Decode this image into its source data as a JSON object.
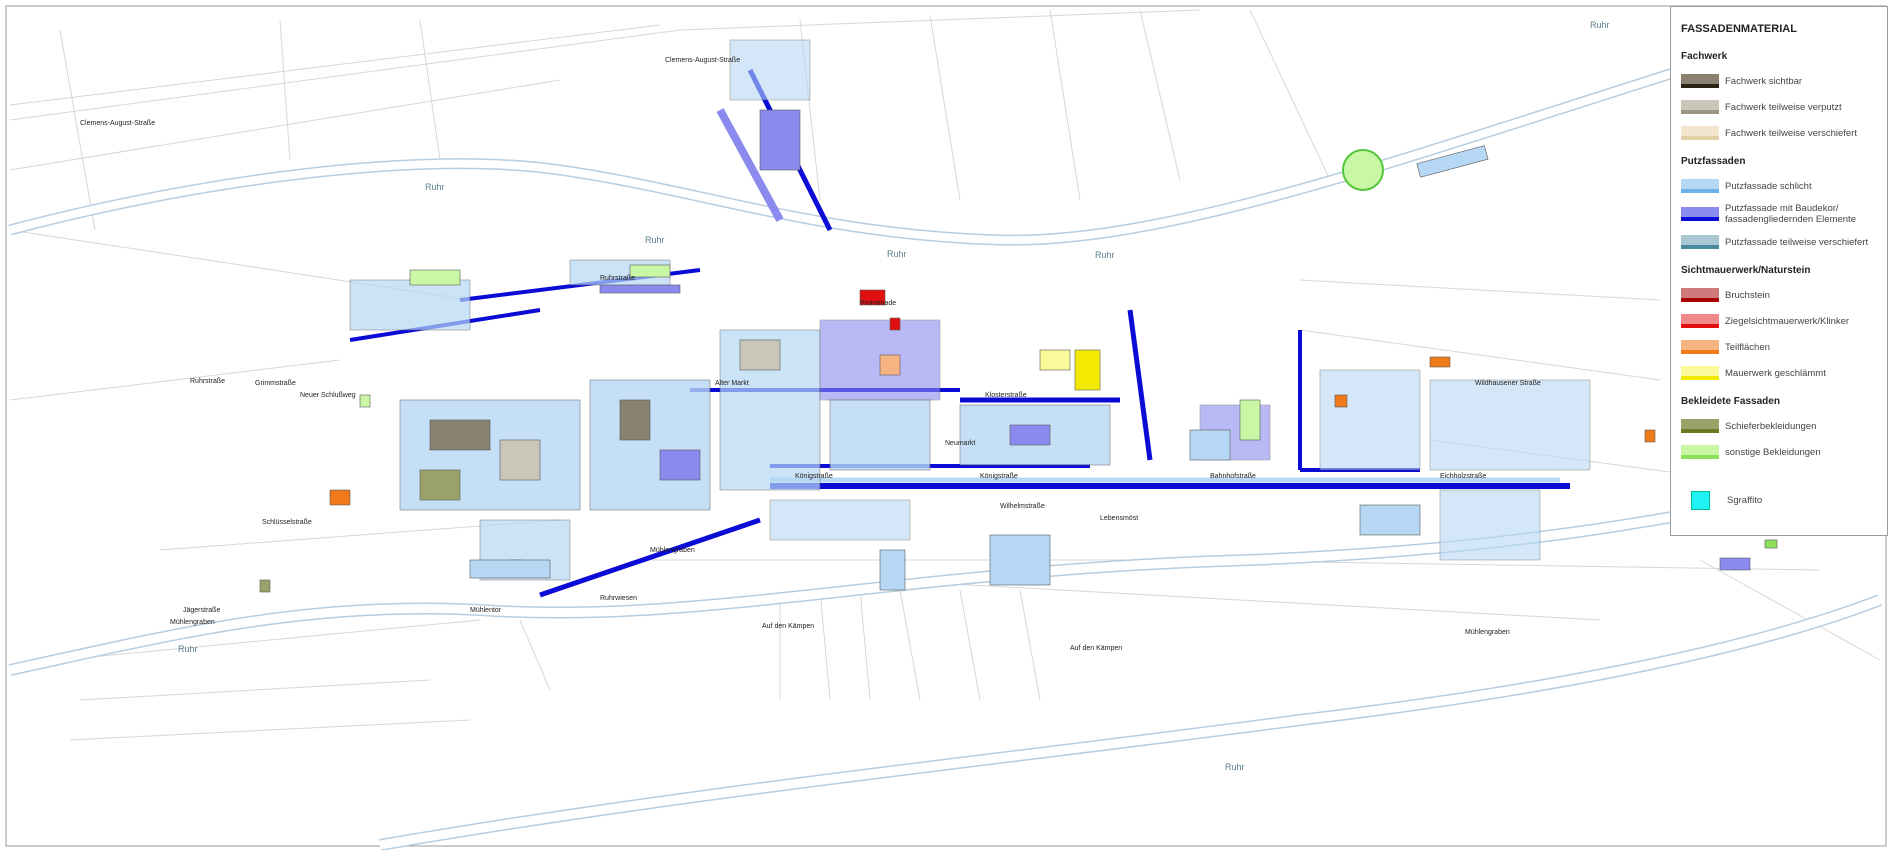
{
  "map": {
    "river_labels": [
      "Ruhr",
      "Ruhr",
      "Ruhr",
      "Ruhr",
      "Ruhr",
      "Ruhr",
      "Ruhr"
    ],
    "street_labels": [
      "Clemens-August-Straße",
      "Clemens-August-Straße",
      "Ruhrstraße",
      "Ruhrstraße",
      "Promenade",
      "Mühlengraben",
      "Auf den Kämpen",
      "Auf den Kämpen",
      "Mühlengraben",
      "Königstraße",
      "Königstraße",
      "Bahnhofstraße",
      "Eichholzstraße",
      "Klosterstraße",
      "Wildhausener Straße",
      "Neumarkt",
      "Alter Markt",
      "Grimmstraße",
      "Neuer Schlußweg",
      "Schlüsselstraße",
      "Jägerstraße",
      "Mühlengraben",
      "Mühlentor",
      "Wilhelmstraße",
      "Ruhrwiesen",
      "Lebensmöst"
    ]
  },
  "legend": {
    "title": "FASSADENMATERIAL",
    "groups": [
      {
        "name": "Fachwerk",
        "items": [
          {
            "label": "Fachwerk sichtbar",
            "color_top": "#8b8170",
            "color_bottom": "#2a2418"
          },
          {
            "label": "Fachwerk teilweise verputzt",
            "color_top": "#cbc6ba",
            "color_bottom": "#9c9586"
          },
          {
            "label": "Fachwerk teilweise verschiefert",
            "color_top": "#f2e6cf",
            "color_bottom": "#e2cfa6"
          }
        ]
      },
      {
        "name": "Putzfassaden",
        "items": [
          {
            "label": "Putzfassade schlicht",
            "color_top": "#b6d8f5",
            "color_bottom": "#6fb2ea"
          },
          {
            "label": "Putzfassade mit Baudekor/ fassadengliedernden Elemente",
            "color_top": "#8b8bef",
            "color_bottom": "#0b0bd6"
          },
          {
            "label": "Putzfassade teilweise verschiefert",
            "color_top": "#a9c7d3",
            "color_bottom": "#4a8aa0"
          }
        ]
      },
      {
        "name": "Sichtmauerwerk/Naturstein",
        "items": [
          {
            "label": "Bruchstein",
            "color_top": "#cf7b7b",
            "color_bottom": "#a80000"
          },
          {
            "label": "Ziegelsichtmauerwerk/Klinker",
            "color_top": "#f08a8a",
            "color_bottom": "#e01010"
          },
          {
            "label": "Teilflächen",
            "color_top": "#f7b483",
            "color_bottom": "#f07a1a"
          },
          {
            "label": "Mauerwerk geschlämmt",
            "color_top": "#fbfa9a",
            "color_bottom": "#f2ea00"
          }
        ]
      },
      {
        "name": "Bekleidete Fassaden",
        "items": [
          {
            "label": "Schieferbekleidungen",
            "color_top": "#9aa26a",
            "color_bottom": "#6a7a20"
          },
          {
            "label": "sonstige Bekleidungen",
            "color_top": "#c9f7a6",
            "color_bottom": "#8ee05a"
          }
        ]
      }
    ],
    "extra": {
      "label": "Sgraffito",
      "color": "#1ef2f2"
    }
  }
}
